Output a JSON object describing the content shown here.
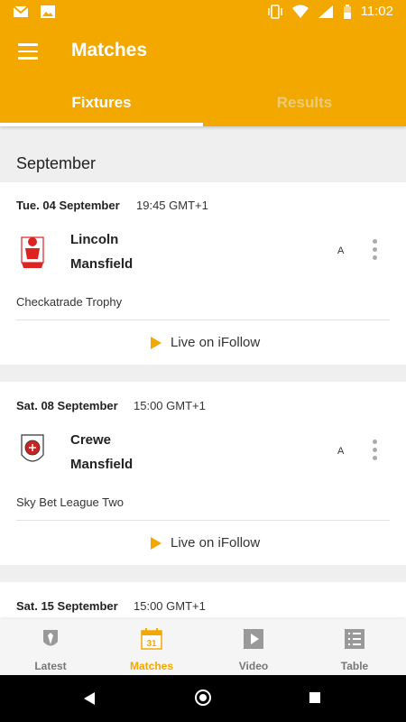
{
  "status_bar": {
    "time": "11:02",
    "icons": [
      "gmail-icon",
      "photo-icon",
      "vibrate-icon",
      "wifi-icon",
      "signal-icon",
      "battery-icon"
    ]
  },
  "app_bar": {
    "title": "Matches",
    "menu_icon": "hamburger-menu-icon"
  },
  "tabs": [
    {
      "label": "Fixtures",
      "active": true
    },
    {
      "label": "Results",
      "active": false
    }
  ],
  "month_header": "September",
  "fixtures": [
    {
      "date": "Tue. 04 September",
      "time": "19:45 GMT+1",
      "home": "Lincoln",
      "away": "Mansfield",
      "venue": "A",
      "competition": "Checkatrade Trophy",
      "live_label": "Live on iFollow"
    },
    {
      "date": "Sat. 08 September",
      "time": "15:00 GMT+1",
      "home": "Crewe",
      "away": "Mansfield",
      "venue": "A",
      "competition": "Sky Bet League Two",
      "live_label": "Live on iFollow"
    },
    {
      "date": "Sat. 15 September",
      "time": "15:00 GMT+1"
    }
  ],
  "bottom_nav": [
    {
      "label": "Latest",
      "icon": "shield-icon",
      "active": false
    },
    {
      "label": "Matches",
      "icon": "calendar-icon",
      "active": true,
      "icon_text": "31"
    },
    {
      "label": "Video",
      "icon": "video-play-icon",
      "active": false
    },
    {
      "label": "Table",
      "icon": "table-list-icon",
      "active": false
    }
  ],
  "colors": {
    "primary": "#f3a800",
    "tab_inactive": "#e8cc79",
    "background": "#efefef"
  }
}
